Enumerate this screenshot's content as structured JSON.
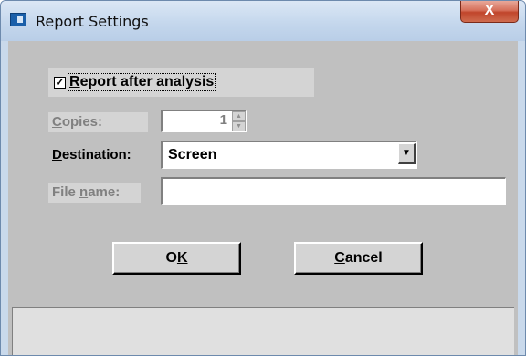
{
  "window": {
    "title": "Report Settings",
    "close_glyph": "X"
  },
  "report_after_analysis": {
    "checked": true,
    "check_mark": "✓",
    "label_prefix": "R",
    "label_rest": "eport after analysis"
  },
  "copies": {
    "label_prefix": "C",
    "label_rest": "opies:",
    "value": "1",
    "enabled": false
  },
  "destination": {
    "label_prefix": "D",
    "label_rest": "estination:",
    "selected": "Screen",
    "arrow_glyph": "▼"
  },
  "file_name": {
    "label_before": "File ",
    "label_hot": "n",
    "label_after": "ame:",
    "value": "",
    "enabled": false
  },
  "buttons": {
    "ok": {
      "before": "O",
      "hot": "K"
    },
    "cancel": {
      "hot": "C",
      "after": "ancel"
    }
  },
  "status_bar": {
    "text": ""
  },
  "icons": {
    "app": "app-window-icon",
    "close": "close-icon",
    "dropdown": "dropdown-arrow-icon",
    "spin": "spin-arrows-icon"
  }
}
